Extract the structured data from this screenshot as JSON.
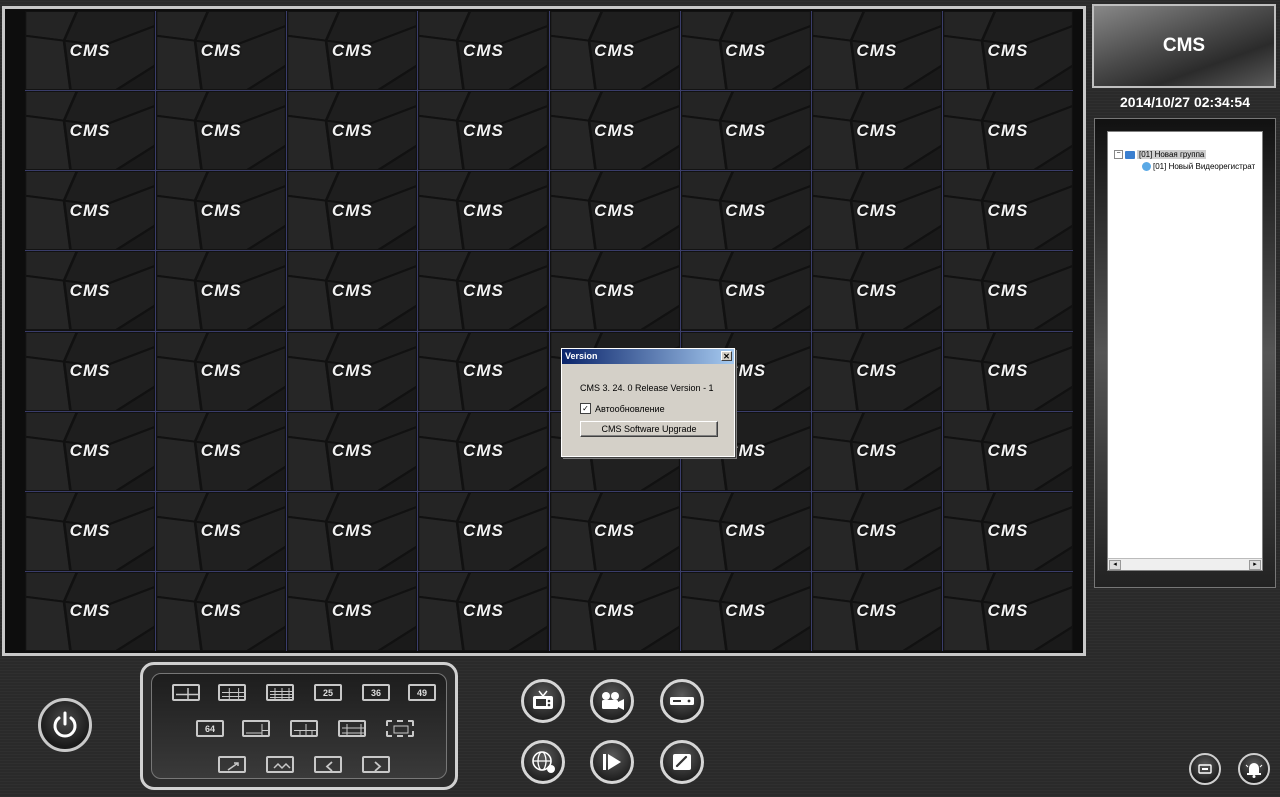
{
  "video_grid": {
    "channel_logo": "CMS",
    "rows": 8,
    "cols": 8
  },
  "version_dialog": {
    "title": "Version",
    "close_glyph": "✕",
    "version_text": "CMS 3. 24. 0 Release Version - 1",
    "auto_update_label": "Автообновление",
    "auto_update_checked": true,
    "check_glyph": "✓",
    "upgrade_button_label": "CMS Software Upgrade"
  },
  "side_panel": {
    "logo_text": "CMS",
    "datetime": "2014/10/27 02:34:54",
    "tree": {
      "group_toggle": "−",
      "group_label": "[01] Новая группа",
      "device_label": "[01] Новый Видеорегистрат"
    },
    "scroll_left_glyph": "◂",
    "scroll_right_glyph": "▸"
  },
  "layout_controls": {
    "count_buttons": [
      "25",
      "36",
      "49",
      "64"
    ]
  },
  "icons": {
    "power": "power-icon",
    "tv": "tv-icon",
    "camera": "video-camera-icon",
    "dvr": "dvr-icon",
    "network": "network-globe-icon",
    "playback": "playback-icon",
    "settings": "settings-icon",
    "remote": "remote-icon",
    "alarm": "alarm-bell-icon"
  },
  "colors": {
    "background": "#2a2a2a",
    "grid_lines": "#3a3d6a",
    "dialog_title_start": "#0a246a",
    "dialog_title_end": "#a6caf0",
    "tree_folder": "#3a7fd0"
  }
}
